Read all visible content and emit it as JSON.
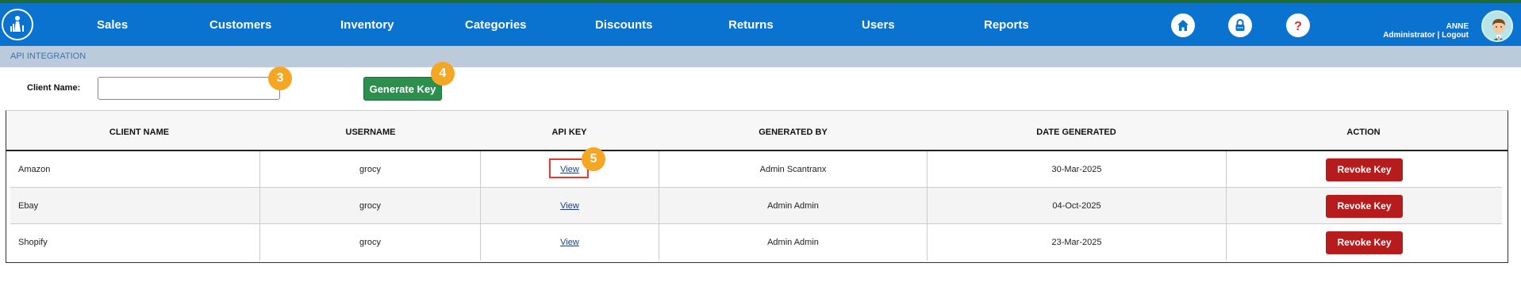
{
  "nav": {
    "items": [
      {
        "label": "Sales"
      },
      {
        "label": "Customers"
      },
      {
        "label": "Inventory"
      },
      {
        "label": "Categories"
      },
      {
        "label": "Discounts"
      },
      {
        "label": "Returns"
      },
      {
        "label": "Users"
      },
      {
        "label": "Reports"
      }
    ],
    "icons": [
      "home-icon",
      "lock-icon",
      "help-icon"
    ],
    "user": {
      "name": "ANNE",
      "role": "Administrator",
      "separator": "|",
      "logout": "Logout"
    }
  },
  "breadcrumb": "API INTEGRATION",
  "form": {
    "client_label": "Client Name:",
    "client_value": "",
    "generate_label": "Generate Key"
  },
  "badges": {
    "input": "3",
    "generate": "4",
    "view": "5"
  },
  "table": {
    "columns": [
      "CLIENT NAME",
      "USERNAME",
      "API KEY",
      "GENERATED BY",
      "DATE GENERATED",
      "ACTION"
    ],
    "rows": [
      {
        "client": "Amazon",
        "username": "grocy",
        "api_key": "View",
        "generated_by": "Admin Scantranx",
        "date": "30-Mar-2025",
        "action": "Revoke Key"
      },
      {
        "client": "Ebay",
        "username": "grocy",
        "api_key": "View",
        "generated_by": "Admin Admin",
        "date": "04-Oct-2025",
        "action": "Revoke Key"
      },
      {
        "client": "Shopify",
        "username": "grocy",
        "api_key": "View",
        "generated_by": "Admin Admin",
        "date": "23-Mar-2025",
        "action": "Revoke Key"
      }
    ]
  },
  "colors": {
    "nav": "#0a73cf",
    "generate": "#2c8f4e",
    "revoke": "#b71c1c",
    "badge": "#f5a623",
    "highlight": "#e53935"
  }
}
